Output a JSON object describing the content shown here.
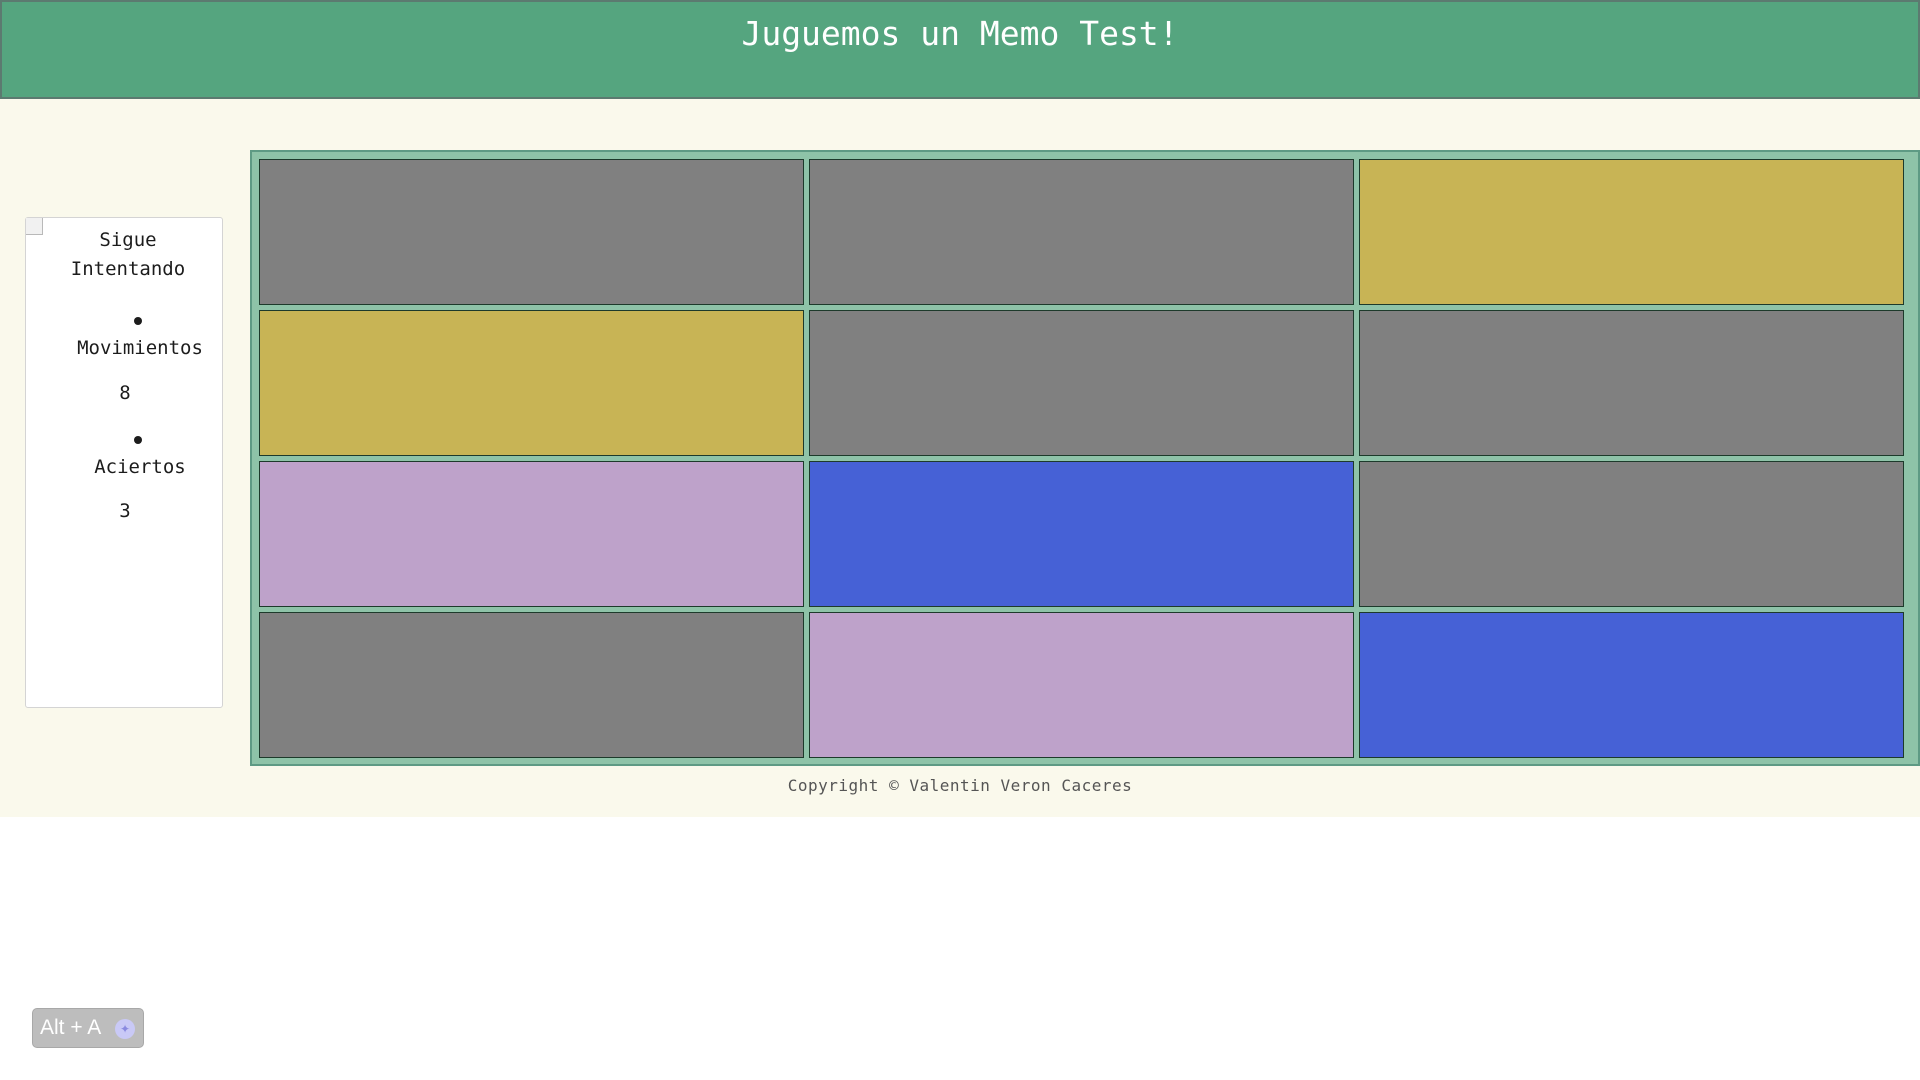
{
  "header": {
    "title": "Juguemos un Memo Test!"
  },
  "stats": {
    "status": "Sigue Intentando",
    "moves_label": "Movimientos",
    "moves_value": "8",
    "hits_label": "Aciertos",
    "hits_value": "3",
    "image_icon": "broken-image-icon"
  },
  "board": {
    "columns": 3,
    "rows": 4,
    "cards": [
      {
        "state": "hidden",
        "color": "#808080"
      },
      {
        "state": "hidden",
        "color": "#808080"
      },
      {
        "state": "revealed",
        "color": "#c8b455"
      },
      {
        "state": "revealed",
        "color": "#c8b455"
      },
      {
        "state": "hidden",
        "color": "#808080"
      },
      {
        "state": "hidden",
        "color": "#808080"
      },
      {
        "state": "revealed",
        "color": "#bea2ca"
      },
      {
        "state": "revealed",
        "color": "#4661d6"
      },
      {
        "state": "hidden",
        "color": "#808080"
      },
      {
        "state": "hidden",
        "color": "#808080"
      },
      {
        "state": "revealed",
        "color": "#bea2ca"
      },
      {
        "state": "revealed",
        "color": "#4661d6"
      }
    ]
  },
  "footer": {
    "copyright": "Copyright © Valentin Veron Caceres"
  },
  "shortcut_badge": {
    "label": "Alt + A",
    "icon": "accessibility-icon"
  },
  "colors": {
    "header": "#55a57f",
    "page_background": "#faf9ec",
    "board_background": "#8ec3a8",
    "hidden_card": "#808080"
  }
}
